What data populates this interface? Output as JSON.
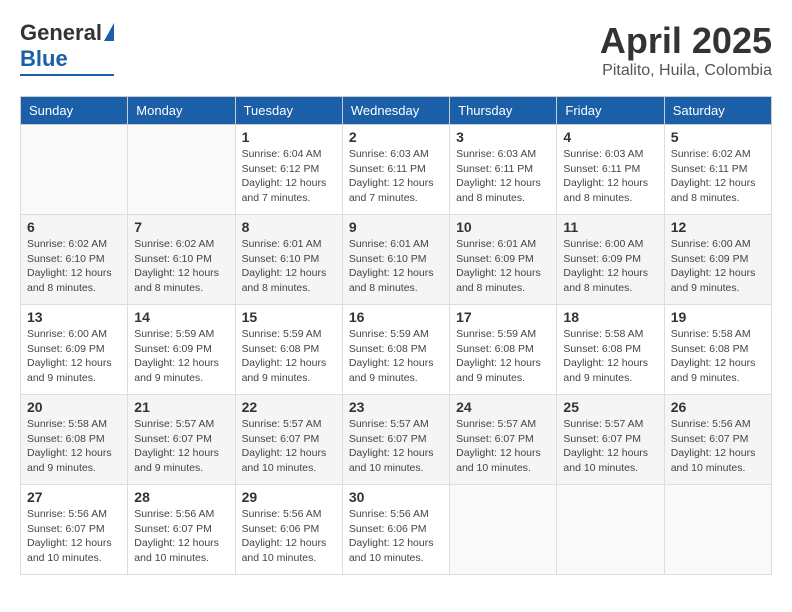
{
  "header": {
    "logo_general": "General",
    "logo_blue": "Blue",
    "month_year": "April 2025",
    "location": "Pitalito, Huila, Colombia"
  },
  "days_of_week": [
    "Sunday",
    "Monday",
    "Tuesday",
    "Wednesday",
    "Thursday",
    "Friday",
    "Saturday"
  ],
  "weeks": [
    [
      {
        "day": "",
        "info": ""
      },
      {
        "day": "",
        "info": ""
      },
      {
        "day": "1",
        "info": "Sunrise: 6:04 AM\nSunset: 6:12 PM\nDaylight: 12 hours and 7 minutes."
      },
      {
        "day": "2",
        "info": "Sunrise: 6:03 AM\nSunset: 6:11 PM\nDaylight: 12 hours and 7 minutes."
      },
      {
        "day": "3",
        "info": "Sunrise: 6:03 AM\nSunset: 6:11 PM\nDaylight: 12 hours and 8 minutes."
      },
      {
        "day": "4",
        "info": "Sunrise: 6:03 AM\nSunset: 6:11 PM\nDaylight: 12 hours and 8 minutes."
      },
      {
        "day": "5",
        "info": "Sunrise: 6:02 AM\nSunset: 6:11 PM\nDaylight: 12 hours and 8 minutes."
      }
    ],
    [
      {
        "day": "6",
        "info": "Sunrise: 6:02 AM\nSunset: 6:10 PM\nDaylight: 12 hours and 8 minutes."
      },
      {
        "day": "7",
        "info": "Sunrise: 6:02 AM\nSunset: 6:10 PM\nDaylight: 12 hours and 8 minutes."
      },
      {
        "day": "8",
        "info": "Sunrise: 6:01 AM\nSunset: 6:10 PM\nDaylight: 12 hours and 8 minutes."
      },
      {
        "day": "9",
        "info": "Sunrise: 6:01 AM\nSunset: 6:10 PM\nDaylight: 12 hours and 8 minutes."
      },
      {
        "day": "10",
        "info": "Sunrise: 6:01 AM\nSunset: 6:09 PM\nDaylight: 12 hours and 8 minutes."
      },
      {
        "day": "11",
        "info": "Sunrise: 6:00 AM\nSunset: 6:09 PM\nDaylight: 12 hours and 8 minutes."
      },
      {
        "day": "12",
        "info": "Sunrise: 6:00 AM\nSunset: 6:09 PM\nDaylight: 12 hours and 9 minutes."
      }
    ],
    [
      {
        "day": "13",
        "info": "Sunrise: 6:00 AM\nSunset: 6:09 PM\nDaylight: 12 hours and 9 minutes."
      },
      {
        "day": "14",
        "info": "Sunrise: 5:59 AM\nSunset: 6:09 PM\nDaylight: 12 hours and 9 minutes."
      },
      {
        "day": "15",
        "info": "Sunrise: 5:59 AM\nSunset: 6:08 PM\nDaylight: 12 hours and 9 minutes."
      },
      {
        "day": "16",
        "info": "Sunrise: 5:59 AM\nSunset: 6:08 PM\nDaylight: 12 hours and 9 minutes."
      },
      {
        "day": "17",
        "info": "Sunrise: 5:59 AM\nSunset: 6:08 PM\nDaylight: 12 hours and 9 minutes."
      },
      {
        "day": "18",
        "info": "Sunrise: 5:58 AM\nSunset: 6:08 PM\nDaylight: 12 hours and 9 minutes."
      },
      {
        "day": "19",
        "info": "Sunrise: 5:58 AM\nSunset: 6:08 PM\nDaylight: 12 hours and 9 minutes."
      }
    ],
    [
      {
        "day": "20",
        "info": "Sunrise: 5:58 AM\nSunset: 6:08 PM\nDaylight: 12 hours and 9 minutes."
      },
      {
        "day": "21",
        "info": "Sunrise: 5:57 AM\nSunset: 6:07 PM\nDaylight: 12 hours and 9 minutes."
      },
      {
        "day": "22",
        "info": "Sunrise: 5:57 AM\nSunset: 6:07 PM\nDaylight: 12 hours and 10 minutes."
      },
      {
        "day": "23",
        "info": "Sunrise: 5:57 AM\nSunset: 6:07 PM\nDaylight: 12 hours and 10 minutes."
      },
      {
        "day": "24",
        "info": "Sunrise: 5:57 AM\nSunset: 6:07 PM\nDaylight: 12 hours and 10 minutes."
      },
      {
        "day": "25",
        "info": "Sunrise: 5:57 AM\nSunset: 6:07 PM\nDaylight: 12 hours and 10 minutes."
      },
      {
        "day": "26",
        "info": "Sunrise: 5:56 AM\nSunset: 6:07 PM\nDaylight: 12 hours and 10 minutes."
      }
    ],
    [
      {
        "day": "27",
        "info": "Sunrise: 5:56 AM\nSunset: 6:07 PM\nDaylight: 12 hours and 10 minutes."
      },
      {
        "day": "28",
        "info": "Sunrise: 5:56 AM\nSunset: 6:07 PM\nDaylight: 12 hours and 10 minutes."
      },
      {
        "day": "29",
        "info": "Sunrise: 5:56 AM\nSunset: 6:06 PM\nDaylight: 12 hours and 10 minutes."
      },
      {
        "day": "30",
        "info": "Sunrise: 5:56 AM\nSunset: 6:06 PM\nDaylight: 12 hours and 10 minutes."
      },
      {
        "day": "",
        "info": ""
      },
      {
        "day": "",
        "info": ""
      },
      {
        "day": "",
        "info": ""
      }
    ]
  ]
}
